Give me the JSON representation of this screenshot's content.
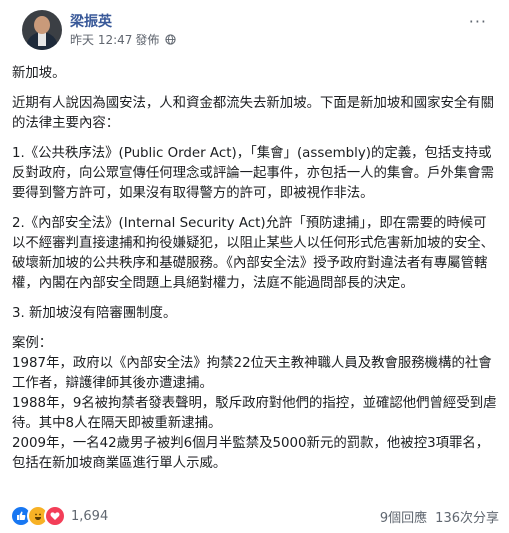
{
  "post": {
    "author": "梁振英",
    "timestamp": "昨天 12:47",
    "publish_label": "發佈",
    "audience_icon": "globe-icon",
    "more_label": "···",
    "paragraphs": [
      "新加坡。",
      "近期有人說因為國安法，人和資金都流失去新加坡。下面是新加坡和國家安全有關的法律主要內容：",
      "1.《公共秩序法》(Public Order Act)，「集會」(assembly)的定義，包括支持或反對政府，向公眾宣傳任何理念或評論一起事件，亦包括一人的集會。戶外集會需要得到警方許可，如果沒有取得警方的許可，即被視作非法。",
      "2.《內部安全法》(Internal Security Act)允許「預防逮捕」，即在需要的時候可以不經審判直接逮捕和拘役嫌疑犯，以阻止某些人以任何形式危害新加坡的安全、破壞新加坡的公共秩序和基礎服務。《內部安全法》授予政府對違法者有專屬管轄權，內閣在內部安全問題上具絕對權力，法庭不能過問部長的決定。",
      "3. 新加坡沒有陪審團制度。"
    ],
    "cases": [
      "案例：",
      "1987年，政府以《內部安全法》拘禁22位天主教神職人員及教會服務機構的社會工作者，辯護律師其後亦遭逮捕。",
      "1988年，9名被拘禁者發表聲明，駁斥政府對他們的指控，並確認他們曾經受到虐待。其中8人在隔天即被重新逮捕。",
      "2009年，一名42歲男子被判6個月半監禁及5000新元的罰款，他被控3項罪名，包括在新加坡商業區進行單人示威。"
    ]
  },
  "footer": {
    "reaction_icons": [
      "like-icon",
      "haha-icon",
      "love-icon"
    ],
    "reaction_count": "1,694",
    "comments": "9個回應",
    "shares": "136次分享"
  },
  "colors": {
    "author": "#385898",
    "like": "#1877f2",
    "haha": "#f7b125",
    "love": "#f33e58",
    "meta": "#616770"
  }
}
